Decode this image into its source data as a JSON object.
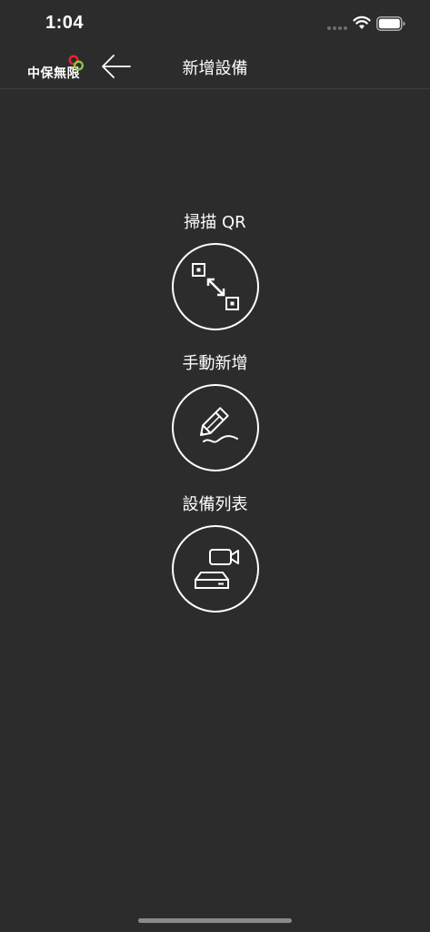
{
  "status_bar": {
    "time": "1:04"
  },
  "header": {
    "brand_name": "中保無限",
    "title": "新增設備"
  },
  "options": [
    {
      "label": "掃描 QR",
      "icon": "qr-scan-icon"
    },
    {
      "label": "手動新增",
      "icon": "pencil-icon"
    },
    {
      "label": "設備列表",
      "icon": "device-list-icon"
    }
  ],
  "colors": {
    "background": "#2c2c2c",
    "foreground": "#ffffff",
    "logo_red": "#e8262c",
    "logo_green": "#8cc63f"
  }
}
